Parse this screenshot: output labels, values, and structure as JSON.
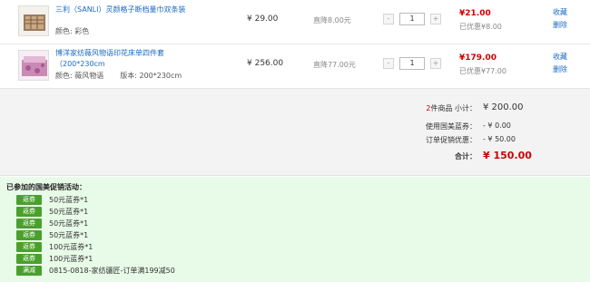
{
  "items": [
    {
      "title": "三利（SANLI）灵颜格子断档量巾双条装",
      "attrs": [
        {
          "label": "颜色: 彩色"
        }
      ],
      "price": "¥ 29.00",
      "drop": "直降8.00元",
      "qty": "1",
      "minus": "-",
      "plus": "+",
      "sale_price": "¥21.00",
      "saved": "已优惠¥8.00",
      "favorite": "收藏",
      "delete": "删除",
      "thumb_icon": "towel-product-image"
    },
    {
      "title": "博洋家纺薇风物语印花床单四件套（200*230cm",
      "attrs": [
        {
          "label": "颜色: 薇风物语"
        },
        {
          "label": "版本: 200*230cm"
        }
      ],
      "price": "¥ 256.00",
      "drop": "直降77.00元",
      "qty": "1",
      "minus": "-",
      "plus": "+",
      "sale_price": "¥179.00",
      "saved": "已优惠¥77.00",
      "favorite": "收藏",
      "delete": "删除",
      "thumb_icon": "bedding-set-product-image"
    }
  ],
  "summary": {
    "count_num": "2",
    "count_label": "件商品 小计：",
    "subtotal": "¥ 200.00",
    "coupon_label": "使用国美蓝券：",
    "coupon_value": "- ¥ 0.00",
    "discount_label": "订单促销优惠：",
    "discount_value": "- ¥ 50.00",
    "total_label": "合计：",
    "total_value": "¥ 150.00"
  },
  "promo": {
    "title": "已参加的国美促销活动：",
    "rows": [
      {
        "tag": "返券",
        "text": "50元蓝券*1"
      },
      {
        "tag": "返券",
        "text": "50元蓝券*1"
      },
      {
        "tag": "返券",
        "text": "50元蓝券*1"
      },
      {
        "tag": "返券",
        "text": "50元蓝券*1"
      },
      {
        "tag": "返券",
        "text": "100元蓝券*1"
      },
      {
        "tag": "返券",
        "text": "100元蓝券*1"
      },
      {
        "tag": "满减",
        "text": "0815-0818-家纺疆匠-订单满199减50"
      }
    ]
  },
  "colors": {
    "link": "#1a6ac5",
    "price_red": "#cc0000",
    "promo_bg": "#e8fbe8",
    "tag_green": "#4aa02c",
    "summary_bg": "#f3f3f3"
  }
}
